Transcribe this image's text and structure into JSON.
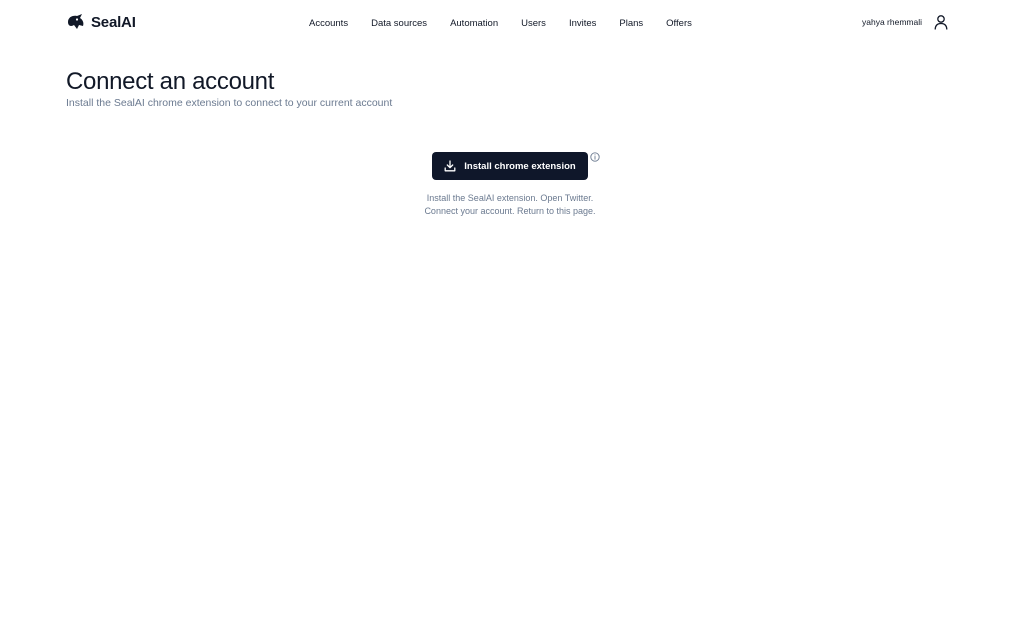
{
  "header": {
    "brand_name": "SealAI",
    "brand_icon": "seal-logo-icon",
    "nav": [
      {
        "label": "Accounts"
      },
      {
        "label": "Data sources"
      },
      {
        "label": "Automation"
      },
      {
        "label": "Users"
      },
      {
        "label": "Invites"
      },
      {
        "label": "Plans"
      },
      {
        "label": "Offers"
      }
    ],
    "user_name": "yahya rhemmali",
    "user_icon": "user-icon"
  },
  "main": {
    "title": "Connect an account",
    "subtitle": "Install the SealAI chrome extension to connect to your current account",
    "install_button_label": "Install chrome extension",
    "install_button_icon": "download-icon",
    "info_icon": "info-icon",
    "instructions_line1": "Install the SealAI extension. Open Twitter.",
    "instructions_line2": "Connect your account. Return to this page."
  },
  "colors": {
    "button_bg": "#0f172a",
    "subtitle_text": "#6b7a90",
    "primary_text": "#111827"
  }
}
